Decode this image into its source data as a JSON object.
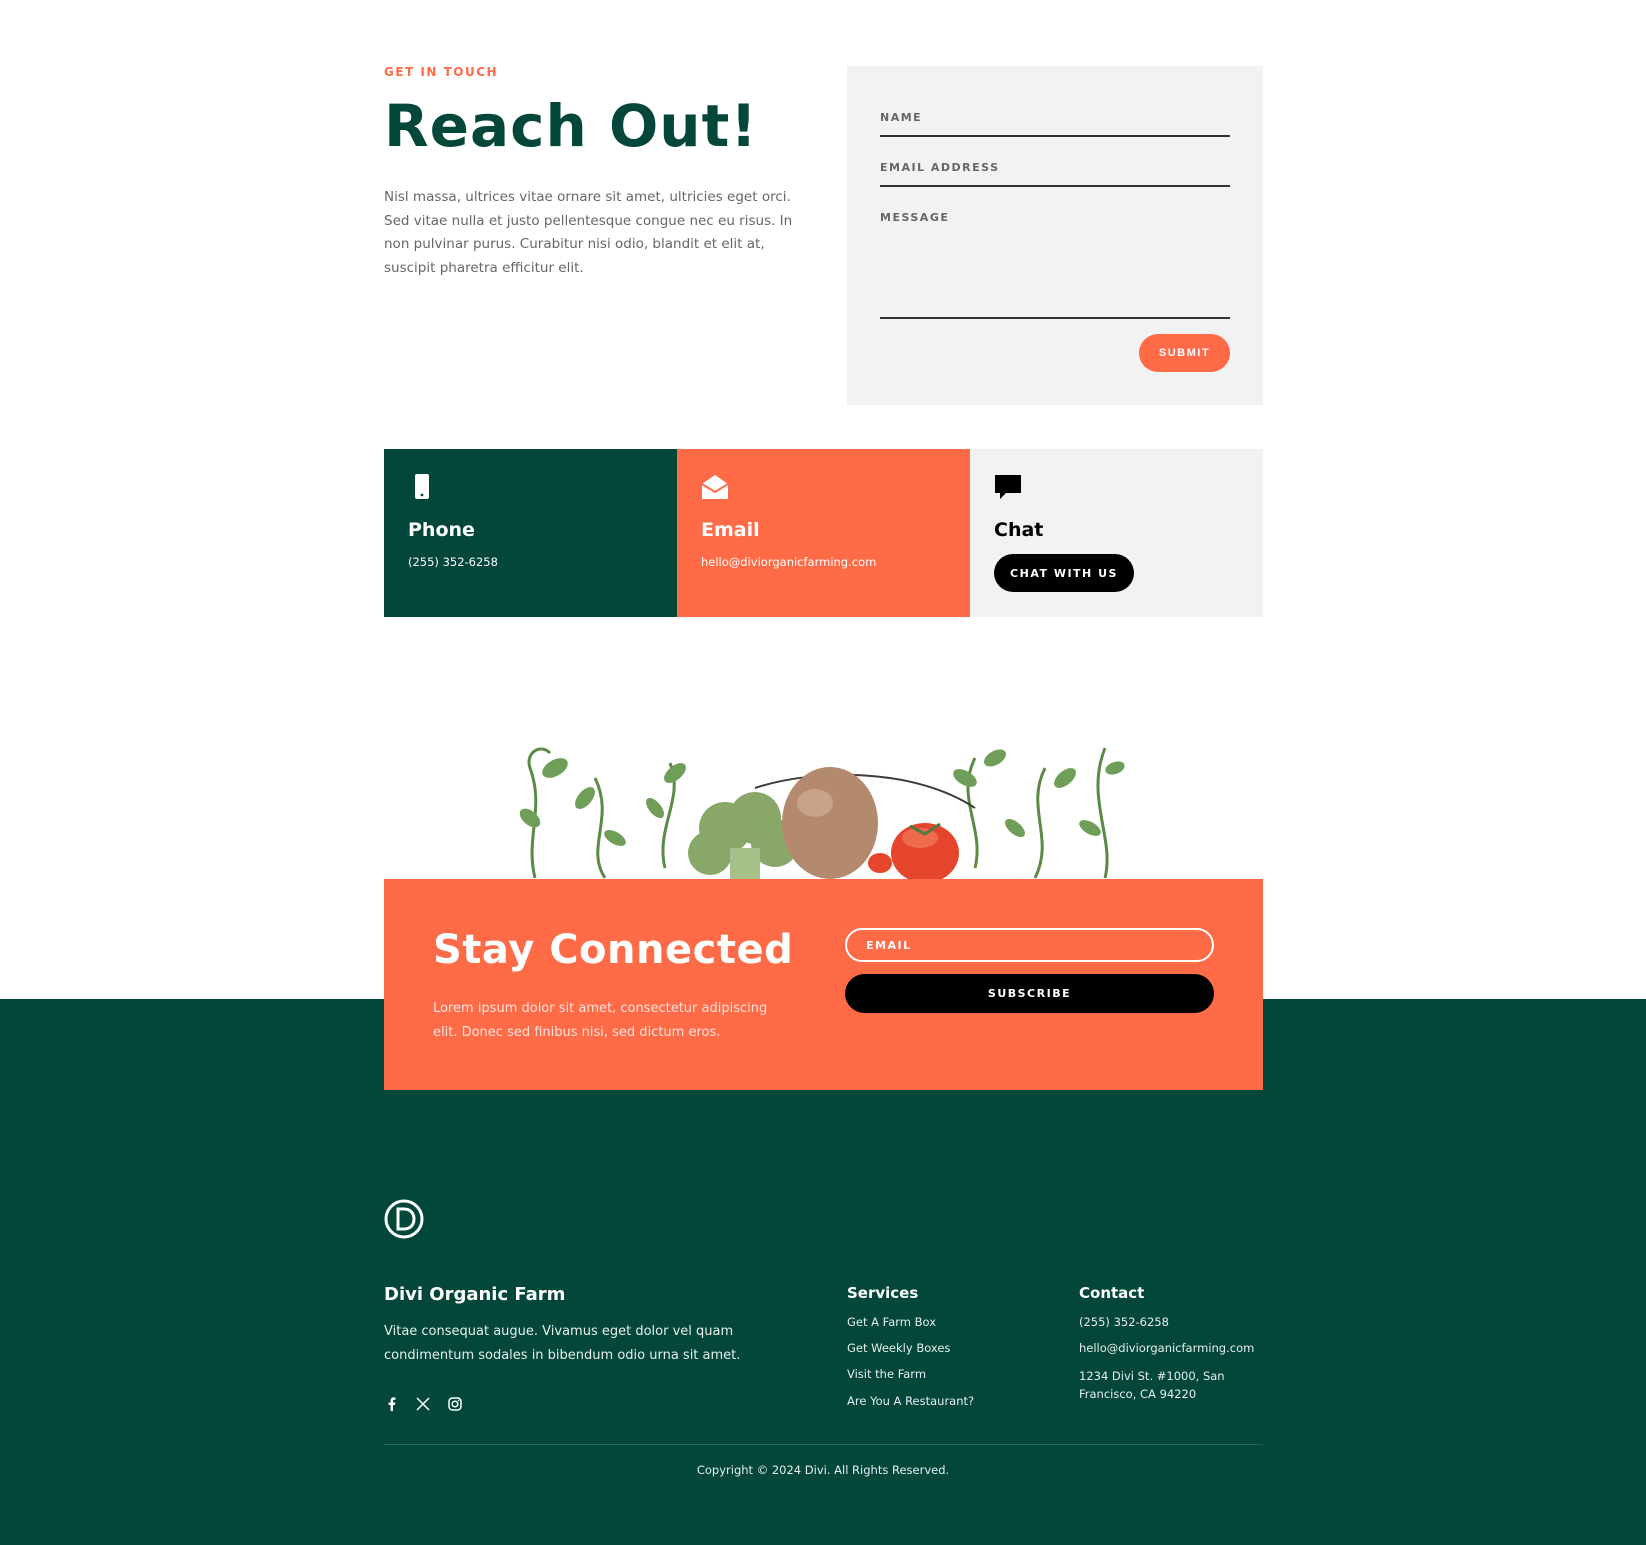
{
  "contact": {
    "eyebrow": "GET IN TOUCH",
    "title": "Reach Out!",
    "intro": "Nisl massa, ultrices vitae ornare sit amet, ultricies eget orci. Sed vitae nulla et justo pellentesque congue nec eu risus. In non pulvinar purus. Curabitur nisi odio, blandit et elit at, suscipit pharetra efficitur elit."
  },
  "form": {
    "name_label": "NAME",
    "email_label": "EMAIL ADDRESS",
    "message_label": "MESSAGE",
    "submit_label": "SUBMIT"
  },
  "cards": {
    "phone": {
      "title": "Phone",
      "value": "(255) 352-6258",
      "icon": "phone-icon"
    },
    "email": {
      "title": "Email",
      "value": "hello@diviorganicfarming.com",
      "icon": "envelope-open-icon"
    },
    "chat": {
      "title": "Chat",
      "button_label": "CHAT WITH US",
      "icon": "chat-bubble-icon"
    }
  },
  "newsletter": {
    "title": "Stay Connected",
    "text": "Lorem ipsum dolor sit amet, consectetur adipiscing elit. Donec sed finibus nisi, sed dictum eros.",
    "email_placeholder": "EMAIL",
    "subscribe_label": "SUBSCRIBE"
  },
  "footer": {
    "brand": "Divi Organic Farm",
    "brand_text": "Vitae consequat augue. Vivamus eget dolor vel quam condimentum sodales in bibendum odio urna sit amet.",
    "services_title": "Services",
    "services": [
      "Get A Farm Box",
      "Get Weekly Boxes",
      "Visit the Farm",
      "Are You A Restaurant?"
    ],
    "contact_title": "Contact",
    "contact_phone": "(255) 352-6258",
    "contact_email": "hello@diviorganicfarming.com",
    "contact_address": "1234 Divi St. #1000, San Francisco, CA 94220",
    "copyright": "Copyright © 2024 Divi. All Rights Reserved."
  },
  "colors": {
    "accent": "#ff6a47",
    "dark_green": "#03463a",
    "light_gray": "#f2f2f2"
  }
}
